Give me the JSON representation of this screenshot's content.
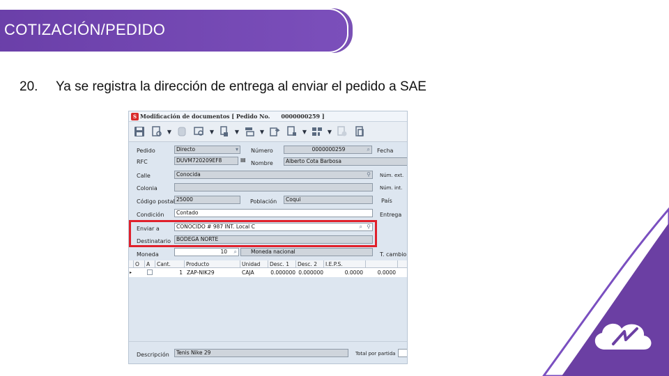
{
  "slide": {
    "title": "COTIZACIÓN/PEDIDO",
    "step_number": "20.",
    "step_text": "Ya se registra la dirección de entrega al enviar el pedido a SAE",
    "accent_color": "#6a3fa8"
  },
  "window": {
    "title": "Modificación de documentos [ Pedido No.",
    "doc_number": "0000000259 ]"
  },
  "toolbar": {
    "icons": [
      "save-icon",
      "preview-icon",
      "print-icon",
      "search-doc-icon",
      "download-icon",
      "transfer-icon",
      "export-icon",
      "copy-icon",
      "barcode-icon",
      "cancel-icon",
      "document-icon"
    ]
  },
  "form": {
    "pedido_label": "Pedido",
    "pedido_value": "Directo",
    "numero_label": "Número",
    "numero_value": "0000000259",
    "fecha_label": "Fecha",
    "rfc_label": "RFC",
    "rfc_value": "DUVM720209EF8",
    "nombre_label": "Nombre",
    "nombre_value": "Alberto Cota Barbosa",
    "calle_label": "Calle",
    "calle_value": "Conocida",
    "num_ext_label": "Núm. ext.",
    "colonia_label": "Colonia",
    "colonia_value": "",
    "num_int_label": "Núm. int.",
    "cp_label": "Código postal",
    "cp_value": "25000",
    "poblacion_label": "Población",
    "poblacion_value": "Coqui",
    "pais_label": "País",
    "condicion_label": "Condición",
    "condicion_value": "Contado",
    "entrega_label": "Entrega",
    "enviar_label": "Enviar a",
    "enviar_value": "CONOCIDO # 987 INT. Local C",
    "destinatario_label": "Destinatario",
    "destinatario_value": "BODEGA NORTE",
    "moneda_label": "Moneda",
    "moneda_value": "10",
    "moneda_name": "Moneda nacional",
    "tcambio_label": "T. cambio"
  },
  "grid": {
    "headers": [
      "O",
      "A",
      "Cant.",
      "Producto",
      "Unidad",
      "Desc. 1",
      "Desc. 2",
      "I.E.P.S."
    ],
    "rows": [
      {
        "cant": "1",
        "producto": "ZAP-NIK29",
        "unidad": "CAJA",
        "desc1": "0.000000",
        "desc2": "0.000000",
        "ieps": "0.0000",
        "extra": "0.0000"
      }
    ]
  },
  "footer": {
    "descripcion_label": "Descripción",
    "descripcion_value": "Tenis Nike 29",
    "total_label": "Total por partida"
  }
}
